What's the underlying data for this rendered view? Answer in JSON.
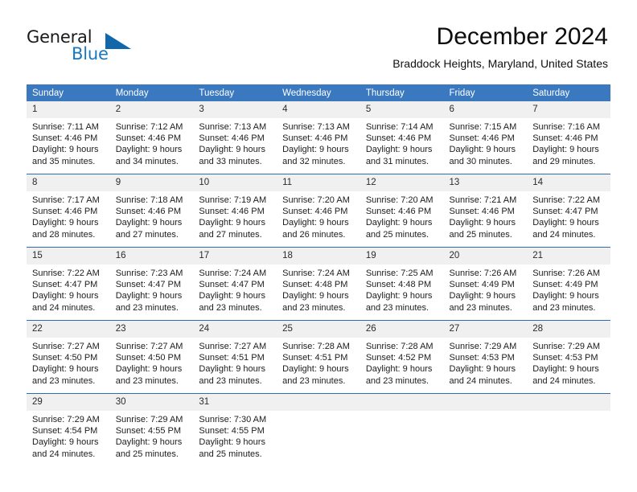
{
  "brand": {
    "name_primary": "General",
    "name_secondary": "Blue",
    "triangle_icon": "triangle-logo-icon"
  },
  "header": {
    "month_title": "December 2024",
    "location": "Braddock Heights, Maryland, United States"
  },
  "colors": {
    "header_blue": "#3a78bf",
    "row_divider_blue": "#2f6bb0",
    "daynum_band": "#f0f0f0",
    "brand_blue": "#1878be",
    "triangle_blue": "#1267ab"
  },
  "calendar": {
    "weekday_headers": [
      "Sunday",
      "Monday",
      "Tuesday",
      "Wednesday",
      "Thursday",
      "Friday",
      "Saturday"
    ],
    "weeks": [
      [
        {
          "day": "1",
          "sunrise": "Sunrise: 7:11 AM",
          "sunset": "Sunset: 4:46 PM",
          "daylight_line1": "Daylight: 9 hours",
          "daylight_line2": "and 35 minutes."
        },
        {
          "day": "2",
          "sunrise": "Sunrise: 7:12 AM",
          "sunset": "Sunset: 4:46 PM",
          "daylight_line1": "Daylight: 9 hours",
          "daylight_line2": "and 34 minutes."
        },
        {
          "day": "3",
          "sunrise": "Sunrise: 7:13 AM",
          "sunset": "Sunset: 4:46 PM",
          "daylight_line1": "Daylight: 9 hours",
          "daylight_line2": "and 33 minutes."
        },
        {
          "day": "4",
          "sunrise": "Sunrise: 7:13 AM",
          "sunset": "Sunset: 4:46 PM",
          "daylight_line1": "Daylight: 9 hours",
          "daylight_line2": "and 32 minutes."
        },
        {
          "day": "5",
          "sunrise": "Sunrise: 7:14 AM",
          "sunset": "Sunset: 4:46 PM",
          "daylight_line1": "Daylight: 9 hours",
          "daylight_line2": "and 31 minutes."
        },
        {
          "day": "6",
          "sunrise": "Sunrise: 7:15 AM",
          "sunset": "Sunset: 4:46 PM",
          "daylight_line1": "Daylight: 9 hours",
          "daylight_line2": "and 30 minutes."
        },
        {
          "day": "7",
          "sunrise": "Sunrise: 7:16 AM",
          "sunset": "Sunset: 4:46 PM",
          "daylight_line1": "Daylight: 9 hours",
          "daylight_line2": "and 29 minutes."
        }
      ],
      [
        {
          "day": "8",
          "sunrise": "Sunrise: 7:17 AM",
          "sunset": "Sunset: 4:46 PM",
          "daylight_line1": "Daylight: 9 hours",
          "daylight_line2": "and 28 minutes."
        },
        {
          "day": "9",
          "sunrise": "Sunrise: 7:18 AM",
          "sunset": "Sunset: 4:46 PM",
          "daylight_line1": "Daylight: 9 hours",
          "daylight_line2": "and 27 minutes."
        },
        {
          "day": "10",
          "sunrise": "Sunrise: 7:19 AM",
          "sunset": "Sunset: 4:46 PM",
          "daylight_line1": "Daylight: 9 hours",
          "daylight_line2": "and 27 minutes."
        },
        {
          "day": "11",
          "sunrise": "Sunrise: 7:20 AM",
          "sunset": "Sunset: 4:46 PM",
          "daylight_line1": "Daylight: 9 hours",
          "daylight_line2": "and 26 minutes."
        },
        {
          "day": "12",
          "sunrise": "Sunrise: 7:20 AM",
          "sunset": "Sunset: 4:46 PM",
          "daylight_line1": "Daylight: 9 hours",
          "daylight_line2": "and 25 minutes."
        },
        {
          "day": "13",
          "sunrise": "Sunrise: 7:21 AM",
          "sunset": "Sunset: 4:46 PM",
          "daylight_line1": "Daylight: 9 hours",
          "daylight_line2": "and 25 minutes."
        },
        {
          "day": "14",
          "sunrise": "Sunrise: 7:22 AM",
          "sunset": "Sunset: 4:47 PM",
          "daylight_line1": "Daylight: 9 hours",
          "daylight_line2": "and 24 minutes."
        }
      ],
      [
        {
          "day": "15",
          "sunrise": "Sunrise: 7:22 AM",
          "sunset": "Sunset: 4:47 PM",
          "daylight_line1": "Daylight: 9 hours",
          "daylight_line2": "and 24 minutes."
        },
        {
          "day": "16",
          "sunrise": "Sunrise: 7:23 AM",
          "sunset": "Sunset: 4:47 PM",
          "daylight_line1": "Daylight: 9 hours",
          "daylight_line2": "and 23 minutes."
        },
        {
          "day": "17",
          "sunrise": "Sunrise: 7:24 AM",
          "sunset": "Sunset: 4:47 PM",
          "daylight_line1": "Daylight: 9 hours",
          "daylight_line2": "and 23 minutes."
        },
        {
          "day": "18",
          "sunrise": "Sunrise: 7:24 AM",
          "sunset": "Sunset: 4:48 PM",
          "daylight_line1": "Daylight: 9 hours",
          "daylight_line2": "and 23 minutes."
        },
        {
          "day": "19",
          "sunrise": "Sunrise: 7:25 AM",
          "sunset": "Sunset: 4:48 PM",
          "daylight_line1": "Daylight: 9 hours",
          "daylight_line2": "and 23 minutes."
        },
        {
          "day": "20",
          "sunrise": "Sunrise: 7:26 AM",
          "sunset": "Sunset: 4:49 PM",
          "daylight_line1": "Daylight: 9 hours",
          "daylight_line2": "and 23 minutes."
        },
        {
          "day": "21",
          "sunrise": "Sunrise: 7:26 AM",
          "sunset": "Sunset: 4:49 PM",
          "daylight_line1": "Daylight: 9 hours",
          "daylight_line2": "and 23 minutes."
        }
      ],
      [
        {
          "day": "22",
          "sunrise": "Sunrise: 7:27 AM",
          "sunset": "Sunset: 4:50 PM",
          "daylight_line1": "Daylight: 9 hours",
          "daylight_line2": "and 23 minutes."
        },
        {
          "day": "23",
          "sunrise": "Sunrise: 7:27 AM",
          "sunset": "Sunset: 4:50 PM",
          "daylight_line1": "Daylight: 9 hours",
          "daylight_line2": "and 23 minutes."
        },
        {
          "day": "24",
          "sunrise": "Sunrise: 7:27 AM",
          "sunset": "Sunset: 4:51 PM",
          "daylight_line1": "Daylight: 9 hours",
          "daylight_line2": "and 23 minutes."
        },
        {
          "day": "25",
          "sunrise": "Sunrise: 7:28 AM",
          "sunset": "Sunset: 4:51 PM",
          "daylight_line1": "Daylight: 9 hours",
          "daylight_line2": "and 23 minutes."
        },
        {
          "day": "26",
          "sunrise": "Sunrise: 7:28 AM",
          "sunset": "Sunset: 4:52 PM",
          "daylight_line1": "Daylight: 9 hours",
          "daylight_line2": "and 23 minutes."
        },
        {
          "day": "27",
          "sunrise": "Sunrise: 7:29 AM",
          "sunset": "Sunset: 4:53 PM",
          "daylight_line1": "Daylight: 9 hours",
          "daylight_line2": "and 24 minutes."
        },
        {
          "day": "28",
          "sunrise": "Sunrise: 7:29 AM",
          "sunset": "Sunset: 4:53 PM",
          "daylight_line1": "Daylight: 9 hours",
          "daylight_line2": "and 24 minutes."
        }
      ],
      [
        {
          "day": "29",
          "sunrise": "Sunrise: 7:29 AM",
          "sunset": "Sunset: 4:54 PM",
          "daylight_line1": "Daylight: 9 hours",
          "daylight_line2": "and 24 minutes."
        },
        {
          "day": "30",
          "sunrise": "Sunrise: 7:29 AM",
          "sunset": "Sunset: 4:55 PM",
          "daylight_line1": "Daylight: 9 hours",
          "daylight_line2": "and 25 minutes."
        },
        {
          "day": "31",
          "sunrise": "Sunrise: 7:30 AM",
          "sunset": "Sunset: 4:55 PM",
          "daylight_line1": "Daylight: 9 hours",
          "daylight_line2": "and 25 minutes."
        },
        {
          "day": "",
          "sunrise": "",
          "sunset": "",
          "daylight_line1": "",
          "daylight_line2": ""
        },
        {
          "day": "",
          "sunrise": "",
          "sunset": "",
          "daylight_line1": "",
          "daylight_line2": ""
        },
        {
          "day": "",
          "sunrise": "",
          "sunset": "",
          "daylight_line1": "",
          "daylight_line2": ""
        },
        {
          "day": "",
          "sunrise": "",
          "sunset": "",
          "daylight_line1": "",
          "daylight_line2": ""
        }
      ]
    ]
  }
}
